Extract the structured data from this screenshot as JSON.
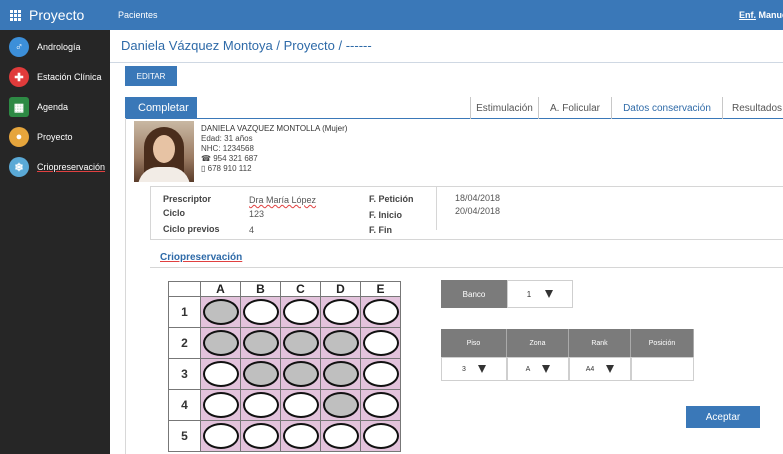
{
  "app": {
    "title": "Proyecto"
  },
  "sidebar": {
    "items": [
      {
        "label": "Andrología",
        "icon": "male-symbol-icon"
      },
      {
        "label": "Estación Clínica",
        "icon": "medical-cross-icon"
      },
      {
        "label": "Agenda",
        "icon": "calendar-icon"
      },
      {
        "label": "Proyecto",
        "icon": "users-group-icon"
      },
      {
        "label": "Criopreservación",
        "icon": "snowflake-icon"
      }
    ]
  },
  "topbar": {
    "section": "Pacientes",
    "user_prefix": "Enf.",
    "user_name": "Manuel Lo"
  },
  "breadcrumb": {
    "text": "Daniela Vázquez Montoya / Proyecto / ------"
  },
  "toolbar": {
    "edit_label": "EDITAR"
  },
  "tabs": {
    "active": "Completar",
    "items": [
      "Estimulación",
      "A. Folicular",
      "Datos conservación",
      "Resultados"
    ]
  },
  "patient": {
    "name": "DANIELA VAZQUEZ MONTOLLA (Mujer)",
    "age": "Edad: 31 años",
    "nhc": "NHC: 1234568",
    "phone": "☎ 954 321 687",
    "mobile": "▯ 678 910 112"
  },
  "details": {
    "prescriptor_label": "Prescriptor",
    "prescriptor_value": "Dra María López",
    "ciclo_label": "Ciclo",
    "ciclo_value": "123",
    "ciclos_prev_label": "Ciclo previos",
    "ciclos_prev_value": "4",
    "f_peticion_label": "F. Petición",
    "f_peticion_value": "18/04/2018",
    "f_inicio_label": "F. Inicio",
    "f_inicio_value": "20/04/2018",
    "f_fin_label": "F. Fin"
  },
  "section": {
    "title": "Criopreservación"
  },
  "grid": {
    "columns": [
      "A",
      "B",
      "C",
      "D",
      "E"
    ],
    "rows": [
      "1",
      "2",
      "3",
      "4",
      "5"
    ],
    "filled": [
      [
        true,
        false,
        false,
        false,
        false
      ],
      [
        true,
        true,
        true,
        true,
        false
      ],
      [
        false,
        true,
        true,
        true,
        false
      ],
      [
        false,
        false,
        false,
        true,
        false
      ],
      [
        false,
        false,
        false,
        false,
        false
      ]
    ],
    "cell_color": "#e3c3dc"
  },
  "banco": {
    "label": "Banco",
    "value": "1"
  },
  "location": {
    "headers": [
      "Piso",
      "Zona",
      "Rank",
      "Posición"
    ],
    "values": [
      "3",
      "A",
      "A4",
      ""
    ]
  },
  "actions": {
    "accept_label": "Aceptar"
  },
  "colors": {
    "accent": "#3a78b8",
    "sidebar": "#262626",
    "header_gray": "#7b7b7b"
  }
}
